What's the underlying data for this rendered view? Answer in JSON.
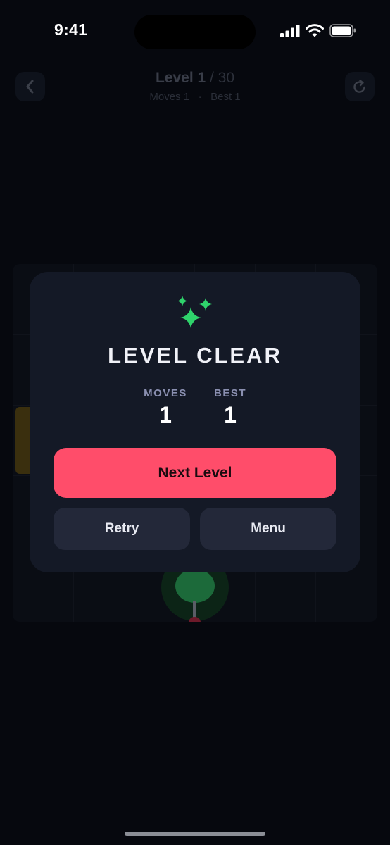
{
  "status_bar": {
    "time": "9:41",
    "icons": [
      "signal-icon",
      "wifi-icon",
      "battery-icon"
    ]
  },
  "header": {
    "level_label": "Level 1",
    "level_total": " / 30",
    "moves_text": "Moves 1",
    "separator": "·",
    "best_text": "Best 1",
    "back_icon": "chevron-left-icon",
    "restart_icon": "restart-icon"
  },
  "modal": {
    "icon": "sparkles-icon",
    "title": "LEVEL CLEAR",
    "stats": {
      "moves_label": "MOVES",
      "moves_value": "1",
      "best_label": "BEST",
      "best_value": "1"
    },
    "next_label": "Next Level",
    "retry_label": "Retry",
    "menu_label": "Menu"
  },
  "colors": {
    "background": "#06080e",
    "modal": "#141926",
    "accent": "#ff4d6a",
    "success": "#2fd36b",
    "secondary_button": "#232839"
  }
}
